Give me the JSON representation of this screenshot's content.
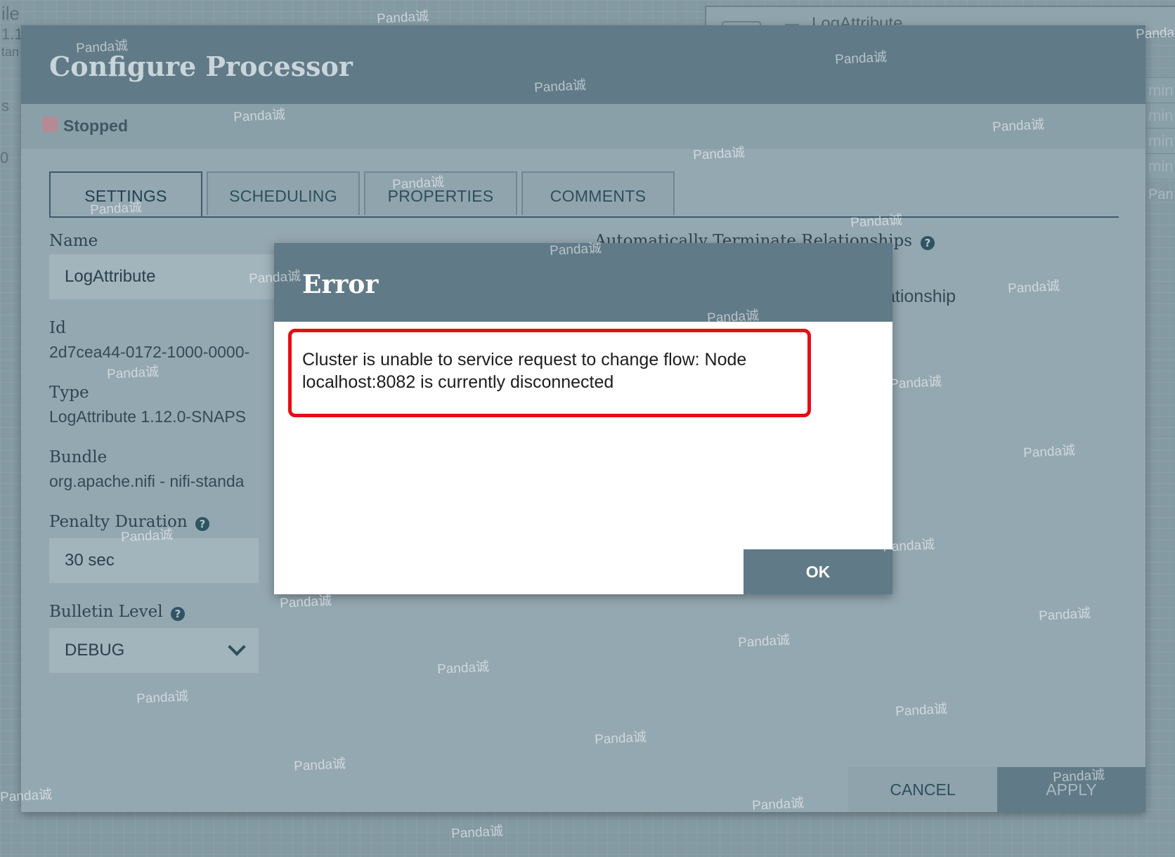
{
  "background": {
    "left_fragments": [
      "ile",
      "1.1",
      "tan",
      "s",
      "0"
    ],
    "panel_title": "LogAttribute",
    "right_fragments": [
      "min",
      "min",
      "min",
      "min",
      "Pan"
    ]
  },
  "dialog": {
    "title": "Configure Processor",
    "status": "Stopped",
    "tabs": [
      "SETTINGS",
      "SCHEDULING",
      "PROPERTIES",
      "COMMENTS"
    ],
    "settings": {
      "name_label": "Name",
      "name_value": "LogAttribute",
      "id_label": "Id",
      "id_value": "2d7cea44-0172-1000-0000-",
      "type_label": "Type",
      "type_value": "LogAttribute 1.12.0-SNAPS",
      "bundle_label": "Bundle",
      "bundle_value": "org.apache.nifi - nifi-standa",
      "penalty_label": "Penalty Duration",
      "penalty_value": "30 sec",
      "bulletin_label": "Bulletin Level",
      "bulletin_value": "DEBUG",
      "auto_terminate_label": "Automatically Terminate Relationships",
      "relationship_fragment": "ationship"
    },
    "cancel_label": "CANCEL",
    "apply_label": "APPLY"
  },
  "error": {
    "title": "Error",
    "message": "Cluster is unable to service request to change flow: Node localhost:8082 is currently disconnected",
    "ok_label": "OK"
  },
  "icons": {
    "help": "question-circle-icon",
    "dropdown": "chevron-down-icon"
  },
  "colors": {
    "header": "#617a87",
    "highlight": "#e60d14"
  },
  "watermark": "Panda诚"
}
